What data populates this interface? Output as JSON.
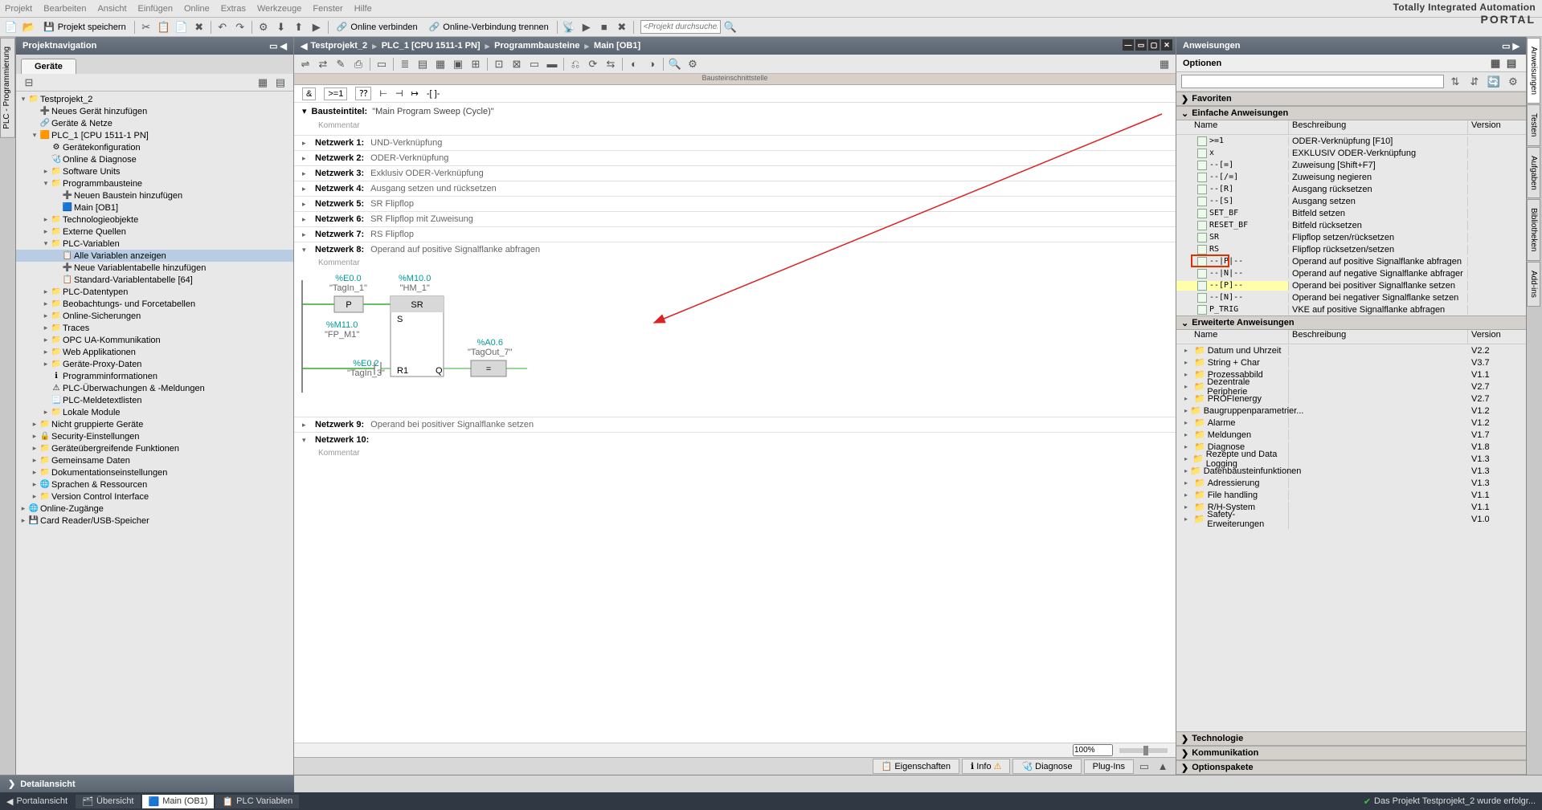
{
  "menus": [
    "Projekt",
    "Bearbeiten",
    "Ansicht",
    "Einfügen",
    "Online",
    "Extras",
    "Werkzeuge",
    "Fenster",
    "Hilfe"
  ],
  "brand": {
    "l1": "Totally Integrated Automation",
    "l2": "PORTAL"
  },
  "toolbar": {
    "save": "Projekt speichern",
    "go_online": "Online verbinden",
    "go_offline": "Online-Verbindung trennen",
    "search_ph": "<Projekt durchsucher"
  },
  "nav_title": "Projektnavigation",
  "devices_tab": "Geräte",
  "tree": [
    {
      "l": 0,
      "c": "▾",
      "i": "📁",
      "t": "Testprojekt_2"
    },
    {
      "l": 1,
      "c": "",
      "i": "➕",
      "t": "Neues Gerät hinzufügen"
    },
    {
      "l": 1,
      "c": "",
      "i": "🔗",
      "t": "Geräte & Netze"
    },
    {
      "l": 1,
      "c": "▾",
      "i": "🟧",
      "t": "PLC_1 [CPU 1511-1 PN]"
    },
    {
      "l": 2,
      "c": "",
      "i": "⚙",
      "t": "Gerätekonfiguration"
    },
    {
      "l": 2,
      "c": "",
      "i": "🩺",
      "t": "Online & Diagnose"
    },
    {
      "l": 2,
      "c": "▸",
      "i": "📁",
      "t": "Software Units"
    },
    {
      "l": 2,
      "c": "▾",
      "i": "📁",
      "t": "Programmbausteine"
    },
    {
      "l": 3,
      "c": "",
      "i": "➕",
      "t": "Neuen Baustein hinzufügen"
    },
    {
      "l": 3,
      "c": "",
      "i": "🟦",
      "t": "Main [OB1]"
    },
    {
      "l": 2,
      "c": "▸",
      "i": "📁",
      "t": "Technologieobjekte"
    },
    {
      "l": 2,
      "c": "▸",
      "i": "📁",
      "t": "Externe Quellen"
    },
    {
      "l": 2,
      "c": "▾",
      "i": "📁",
      "t": "PLC-Variablen"
    },
    {
      "l": 3,
      "c": "",
      "i": "📋",
      "t": "Alle Variablen anzeigen",
      "sel": true
    },
    {
      "l": 3,
      "c": "",
      "i": "➕",
      "t": "Neue Variablentabelle hinzufügen"
    },
    {
      "l": 3,
      "c": "",
      "i": "📋",
      "t": "Standard-Variablentabelle [64]"
    },
    {
      "l": 2,
      "c": "▸",
      "i": "📁",
      "t": "PLC-Datentypen"
    },
    {
      "l": 2,
      "c": "▸",
      "i": "📁",
      "t": "Beobachtungs- und Forcetabellen"
    },
    {
      "l": 2,
      "c": "▸",
      "i": "📁",
      "t": "Online-Sicherungen"
    },
    {
      "l": 2,
      "c": "▸",
      "i": "📁",
      "t": "Traces"
    },
    {
      "l": 2,
      "c": "▸",
      "i": "📁",
      "t": "OPC UA-Kommunikation"
    },
    {
      "l": 2,
      "c": "▸",
      "i": "📁",
      "t": "Web Applikationen"
    },
    {
      "l": 2,
      "c": "▸",
      "i": "📁",
      "t": "Geräte-Proxy-Daten"
    },
    {
      "l": 2,
      "c": "",
      "i": "ℹ",
      "t": "Programminformationen"
    },
    {
      "l": 2,
      "c": "",
      "i": "⚠",
      "t": "PLC-Überwachungen & -Meldungen"
    },
    {
      "l": 2,
      "c": "",
      "i": "📃",
      "t": "PLC-Meldetextlisten"
    },
    {
      "l": 2,
      "c": "▸",
      "i": "📁",
      "t": "Lokale Module"
    },
    {
      "l": 1,
      "c": "▸",
      "i": "📁",
      "t": "Nicht gruppierte Geräte"
    },
    {
      "l": 1,
      "c": "▸",
      "i": "🔒",
      "t": "Security-Einstellungen"
    },
    {
      "l": 1,
      "c": "▸",
      "i": "📁",
      "t": "Geräteübergreifende Funktionen"
    },
    {
      "l": 1,
      "c": "▸",
      "i": "📁",
      "t": "Gemeinsame Daten"
    },
    {
      "l": 1,
      "c": "▸",
      "i": "📁",
      "t": "Dokumentationseinstellungen"
    },
    {
      "l": 1,
      "c": "▸",
      "i": "🌐",
      "t": "Sprachen & Ressourcen"
    },
    {
      "l": 1,
      "c": "▸",
      "i": "📁",
      "t": "Version Control Interface"
    },
    {
      "l": 0,
      "c": "▸",
      "i": "🌐",
      "t": "Online-Zugänge"
    },
    {
      "l": 0,
      "c": "▸",
      "i": "💾",
      "t": "Card Reader/USB-Speicher"
    }
  ],
  "vtab_left": "PLC - Programmierung",
  "crumb": [
    "Testprojekt_2",
    "PLC_1 [CPU 1511-1 PN]",
    "Programmbausteine",
    "Main [OB1]"
  ],
  "iface_label": "Bausteinschnittstelle",
  "block_title": {
    "lbl": "Bausteintitel:",
    "val": "\"Main Program Sweep (Cycle)\"",
    "comment": "Kommentar"
  },
  "networks": [
    {
      "n": "Netzwerk 1:",
      "d": "UND-Verknüpfung",
      "open": false
    },
    {
      "n": "Netzwerk 2:",
      "d": "ODER-Verknüpfung",
      "open": false
    },
    {
      "n": "Netzwerk 3:",
      "d": "Exklusiv ODER-Verknüpfung",
      "open": false
    },
    {
      "n": "Netzwerk 4:",
      "d": "Ausgang setzen und rücksetzen",
      "open": false
    },
    {
      "n": "Netzwerk 5:",
      "d": "SR Flipflop",
      "open": false
    },
    {
      "n": "Netzwerk 6:",
      "d": "SR Flipflop mit Zuweisung",
      "open": false
    },
    {
      "n": "Netzwerk 7:",
      "d": "RS Flipflop",
      "open": false
    },
    {
      "n": "Netzwerk 8:",
      "d": "Operand auf positive Signalflanke abfragen",
      "open": true,
      "comment": "Kommentar",
      "lad": {
        "tagin1": {
          "addr": "%E0.0",
          "name": "\"TagIn_1\""
        },
        "p": "P",
        "fp": {
          "addr": "%M11.0",
          "name": "\"FP_M1\""
        },
        "hm": {
          "addr": "%M10.0",
          "name": "\"HM_1\""
        },
        "sr": "SR",
        "s": "S",
        "r1": "R1",
        "q": "Q",
        "tagin3": {
          "addr": "%E0.2",
          "name": "\"TagIn_3\""
        },
        "tagout": {
          "addr": "%A0.6",
          "name": "\"TagOut_7\""
        },
        "assign": "="
      }
    },
    {
      "n": "Netzwerk 9:",
      "d": "Operand bei positiver Signalflanke setzen",
      "open": false
    },
    {
      "n": "Netzwerk 10:",
      "d": "",
      "open": true,
      "comment": "Kommentar"
    }
  ],
  "zoom": "100%",
  "ftabs": [
    {
      "i": "📋",
      "t": "Eigenschaften"
    },
    {
      "i": "ℹ",
      "t": "Info",
      "b": "⚠"
    },
    {
      "i": "🩺",
      "t": "Diagnose"
    },
    {
      "i": "",
      "t": "Plug-Ins"
    }
  ],
  "right_title": "Anweisungen",
  "options": "Optionen",
  "sections": {
    "fav": "Favoriten",
    "basic": "Einfache Anweisungen",
    "ext": "Erweiterte Anweisungen",
    "tech": "Technologie",
    "comm": "Kommunikation",
    "optpkg": "Optionspakete"
  },
  "cols": {
    "name": "Name",
    "desc": "Beschreibung",
    "ver": "Version"
  },
  "instr": [
    {
      "s": ">=1",
      "d": "ODER-Verknüpfung [F10]"
    },
    {
      "s": "x",
      "d": "EXKLUSIV ODER-Verknüpfung"
    },
    {
      "s": "--[=]",
      "d": "Zuweisung [Shift+F7]"
    },
    {
      "s": "--[/=]",
      "d": "Zuweisung negieren"
    },
    {
      "s": "--[R]",
      "d": "Ausgang rücksetzen"
    },
    {
      "s": "--[S]",
      "d": "Ausgang setzen"
    },
    {
      "s": "SET_BF",
      "d": "Bitfeld setzen"
    },
    {
      "s": "RESET_BF",
      "d": "Bitfeld rücksetzen"
    },
    {
      "s": "SR",
      "d": "Flipflop setzen/rücksetzen"
    },
    {
      "s": "RS",
      "d": "Flipflop rücksetzen/setzen"
    },
    {
      "s": "--|P|--",
      "d": "Operand auf positive Signalflanke abfragen",
      "mark": true
    },
    {
      "s": "--|N|--",
      "d": "Operand auf negative Signalflanke abfrager"
    },
    {
      "s": "--[P]--",
      "d": "Operand bei positiver Signalflanke setzen",
      "hl": true
    },
    {
      "s": "--[N]--",
      "d": "Operand bei negativer Signalflanke setzen"
    },
    {
      "s": "P_TRIG",
      "d": "VKE auf positive Signalflanke abfragen"
    }
  ],
  "ext_instr": [
    {
      "t": "Datum und Uhrzeit",
      "v": "V2.2"
    },
    {
      "t": "String + Char",
      "v": "V3.7"
    },
    {
      "t": "Prozessabbild",
      "v": "V1.1"
    },
    {
      "t": "Dezentrale Peripherie",
      "v": "V2.7"
    },
    {
      "t": "PROFIenergy",
      "v": "V2.7"
    },
    {
      "t": "Baugruppenparametrier...",
      "v": "V1.2"
    },
    {
      "t": "Alarme",
      "v": "V1.2"
    },
    {
      "t": "Meldungen",
      "v": "V1.7"
    },
    {
      "t": "Diagnose",
      "v": "V1.8"
    },
    {
      "t": "Rezepte und Data Logging",
      "v": "V1.3"
    },
    {
      "t": "Datenbausteinfunktionen",
      "v": "V1.3"
    },
    {
      "t": "Adressierung",
      "v": "V1.3"
    },
    {
      "t": "File handling",
      "v": "V1.1"
    },
    {
      "t": "R/H-System",
      "v": "V1.1"
    },
    {
      "t": "Safety-Erweiterungen",
      "v": "V1.0"
    }
  ],
  "vtabs_right": [
    "Anweisungen",
    "Testen",
    "Aufgaben",
    "Bibliotheken",
    "Add-ins"
  ],
  "detail": "Detailansicht",
  "portal": "Portalansicht",
  "status_tabs": [
    {
      "i": "🗂",
      "t": "Übersicht"
    },
    {
      "i": "🟦",
      "t": "Main (OB1)",
      "active": true
    },
    {
      "i": "📋",
      "t": "PLC Variablen"
    }
  ],
  "status_msg": "Das Projekt Testprojekt_2 wurde erfolgr..."
}
